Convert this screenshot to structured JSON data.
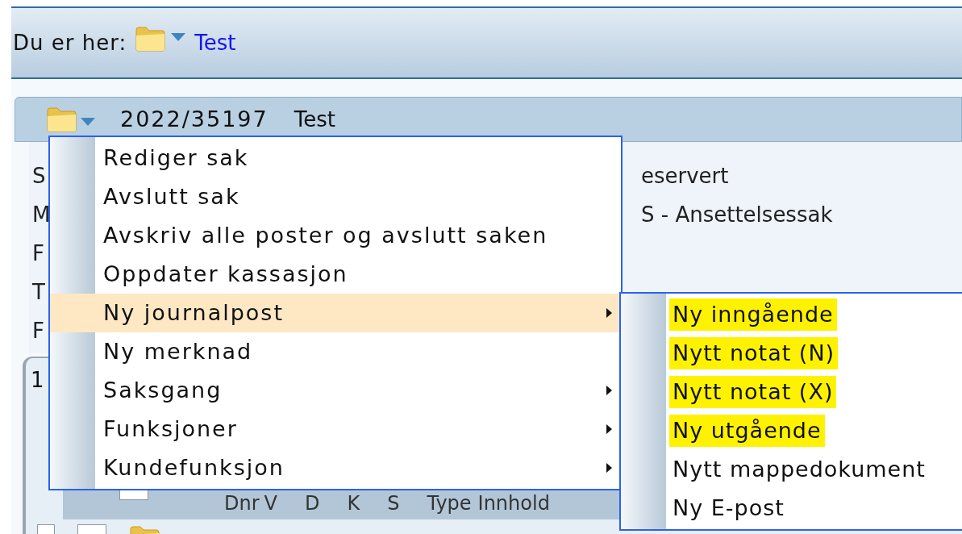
{
  "breadcrumb": {
    "label": "Du er her:",
    "link": "Test"
  },
  "case_header": {
    "number": "2022/35197",
    "title": "Test"
  },
  "details": {
    "labels": [
      "S",
      "M",
      "F",
      "T",
      "F"
    ],
    "values": [
      "eservert",
      "S - Ansettelsessak"
    ]
  },
  "tabs": [
    {
      "label": "1"
    }
  ],
  "table": {
    "select_all": {
      "checked": false
    },
    "columns": [
      "Dnr",
      "V",
      "D",
      "K",
      "S",
      "Type",
      "Innhold"
    ],
    "rows": [
      {
        "checked": false
      }
    ]
  },
  "context_menu": {
    "items": [
      {
        "label": "Rediger sak",
        "selected": false,
        "submenu": false
      },
      {
        "label": "Avslutt sak",
        "selected": false,
        "submenu": false
      },
      {
        "label": "Avskriv alle poster og avslutt saken",
        "selected": false,
        "submenu": false
      },
      {
        "label": "Oppdater kassasjon",
        "selected": false,
        "submenu": false
      },
      {
        "label": "Ny journalpost",
        "selected": true,
        "submenu": true
      },
      {
        "label": "Ny merknad",
        "selected": false,
        "submenu": false
      },
      {
        "label": "Saksgang",
        "selected": false,
        "submenu": true
      },
      {
        "label": "Funksjoner",
        "selected": false,
        "submenu": true
      },
      {
        "label": "Kundefunksjon",
        "selected": false,
        "submenu": true
      }
    ]
  },
  "submenu": {
    "items": [
      {
        "label": "Ny inngående",
        "highlighted": true
      },
      {
        "label": "Nytt notat (N)",
        "highlighted": true
      },
      {
        "label": "Nytt notat (X)",
        "highlighted": true
      },
      {
        "label": "Ny utgående",
        "highlighted": true
      },
      {
        "label": "Nytt mappedokument",
        "highlighted": false
      },
      {
        "label": "Ny E-post",
        "highlighted": false
      }
    ]
  }
}
